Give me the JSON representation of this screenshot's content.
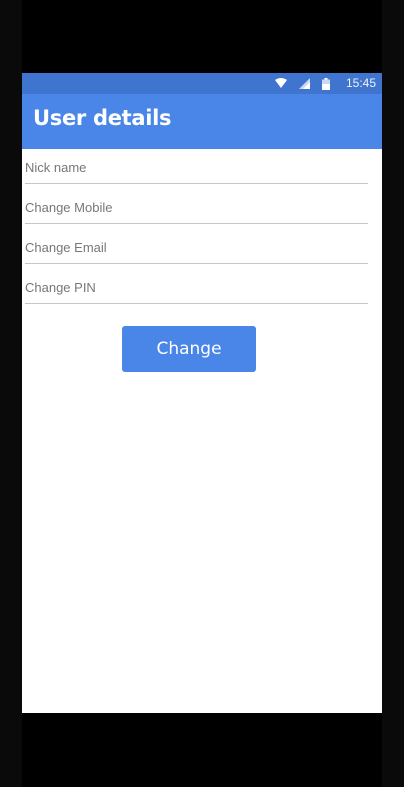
{
  "status_bar": {
    "time": "15:45",
    "icons": [
      "wifi-icon",
      "cell-signal-icon",
      "battery-icon"
    ]
  },
  "app_bar": {
    "title": "User details"
  },
  "form": {
    "fields": [
      {
        "placeholder": "Nick name",
        "value": ""
      },
      {
        "placeholder": "Change Mobile",
        "value": ""
      },
      {
        "placeholder": "Change Email",
        "value": ""
      },
      {
        "placeholder": "Change PIN",
        "value": ""
      }
    ],
    "submit_label": "Change"
  },
  "colors": {
    "primary": "#4a86e8",
    "status_bar": "#3f74cf",
    "background": "#ffffff",
    "divider": "#c7c7c7",
    "hint_text": "#777777"
  }
}
